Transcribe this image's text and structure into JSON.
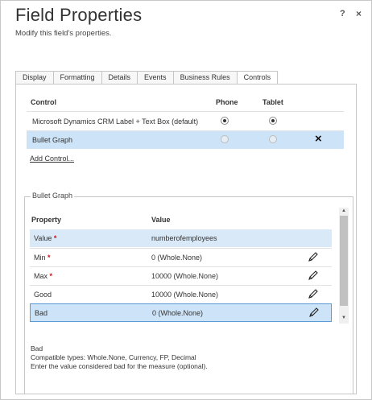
{
  "dialog": {
    "title": "Field Properties",
    "subtitle": "Modify this field's properties.",
    "help_label": "?",
    "close_label": "×"
  },
  "tabs": [
    {
      "label": "Display",
      "active": false
    },
    {
      "label": "Formatting",
      "active": false
    },
    {
      "label": "Details",
      "active": false
    },
    {
      "label": "Events",
      "active": false
    },
    {
      "label": "Business Rules",
      "active": false
    },
    {
      "label": "Controls",
      "active": true
    }
  ],
  "controls": {
    "headers": {
      "control": "Control",
      "phone": "Phone",
      "tablet": "Tablet"
    },
    "rows": [
      {
        "name": "Microsoft Dynamics CRM Label + Text Box (default)",
        "phone": true,
        "tablet": true,
        "selected": false
      },
      {
        "name": "Bullet Graph",
        "phone": false,
        "tablet": false,
        "selected": true,
        "remove_icon": "×"
      }
    ],
    "add_link": "Add Control..."
  },
  "bullet_graph": {
    "legend": "Bullet Graph",
    "headers": {
      "property": "Property",
      "value": "Value"
    },
    "rows": [
      {
        "name": "Value",
        "required": true,
        "value": "numberofemployees",
        "editable": false
      },
      {
        "name": "Min",
        "required": true,
        "value": "0 (Whole.None)",
        "editable": true
      },
      {
        "name": "Max",
        "required": true,
        "value": "10000 (Whole.None)",
        "editable": true
      },
      {
        "name": "Good",
        "required": false,
        "value": "10000 (Whole.None)",
        "editable": true
      },
      {
        "name": "Bad",
        "required": false,
        "value": "0 (Whole.None)",
        "editable": true
      }
    ],
    "required_mark": "*"
  },
  "help": {
    "title": "Bad",
    "compatible": "Compatible types: Whole.None, Currency, FP, Decimal",
    "description": "Enter the value considered bad for the measure (optional)."
  },
  "colors": {
    "selected_row": "#cde3f7",
    "selected_border": "#5b9bd5",
    "required": "#d01010"
  },
  "icons": {
    "edit": "pencil-icon",
    "remove": "close-x-icon",
    "scroll_up": "scroll-up-arrow",
    "scroll_down": "scroll-down-arrow"
  }
}
